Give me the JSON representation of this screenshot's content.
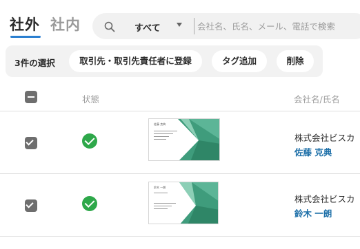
{
  "tabs": {
    "external": "社外",
    "internal": "社内"
  },
  "search": {
    "filter_value": "すべて",
    "placeholder": "会社名、氏名、メール、電話で検索",
    "value": ""
  },
  "actions": {
    "selection_count": "3件の選択",
    "register": "取引先・取引先責任者に登録",
    "add_tag": "タグ追加",
    "delete": "削除"
  },
  "table": {
    "columns": {
      "status": "状態",
      "company_person": "会社名/氏名"
    },
    "rows": [
      {
        "checked": true,
        "status": "ok",
        "card_name": "佐藤 克典",
        "company": "株式会社ビスカ",
        "person": "佐藤 克典"
      },
      {
        "checked": true,
        "status": "ok",
        "card_name": "鈴木 一朗",
        "company": "株式会社ビスカ",
        "person": "鈴木 一朗"
      }
    ]
  },
  "colors": {
    "accent": "#2a7fd0",
    "status_ok": "#2ea84a",
    "person_link": "#1d6fa8",
    "card_green": "#3f9c7c"
  }
}
